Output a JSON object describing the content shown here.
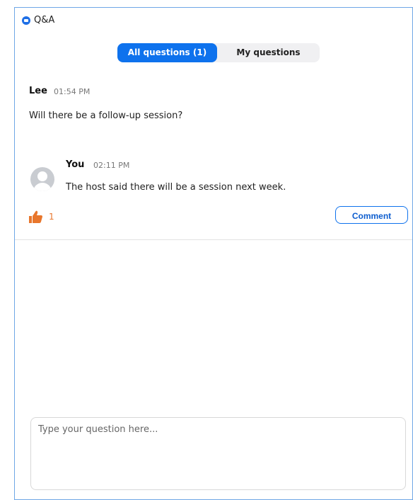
{
  "window": {
    "title": "Q&A"
  },
  "tabs": [
    {
      "label": "All questions (1)",
      "active": true
    },
    {
      "label": "My questions",
      "active": false
    }
  ],
  "question": {
    "author": "Lee",
    "time": "01:54 PM",
    "text": "Will there be a follow-up session?"
  },
  "answer": {
    "author": "You",
    "time": "02:11 PM",
    "text": "The host said there will be a session next week."
  },
  "likes": {
    "count": "1"
  },
  "comment_label": "Comment",
  "input": {
    "placeholder": "Type your question here...",
    "value": ""
  },
  "colors": {
    "accent": "#0e72ed",
    "like": "#e8762c",
    "window_border": "#6fa7e6"
  },
  "icons": {
    "app": "zoom-logo-icon",
    "avatar": "default-avatar-icon",
    "like": "thumbs-up-icon"
  }
}
